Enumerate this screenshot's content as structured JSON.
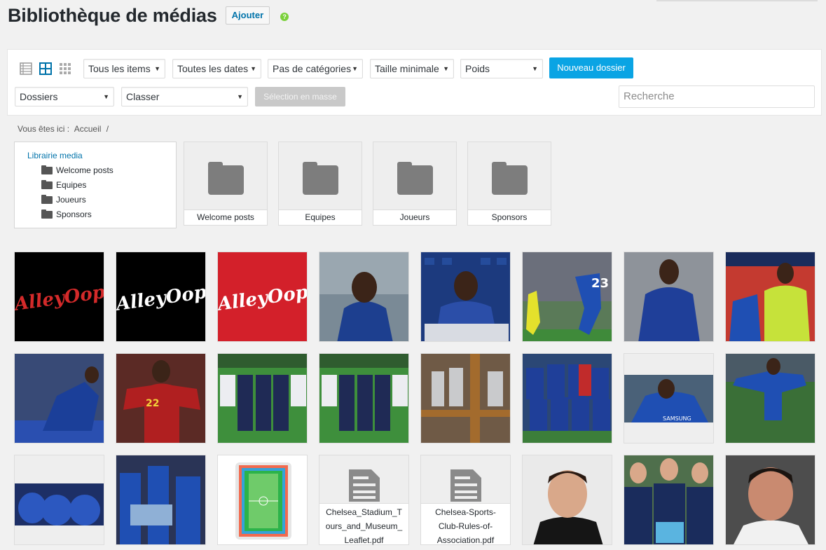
{
  "header": {
    "title": "Bibliothèque de médias",
    "add_label": "Ajouter",
    "help": "?"
  },
  "toolbar": {
    "filters": [
      {
        "label": "Tous les items"
      },
      {
        "label": "Toutes les dates"
      },
      {
        "label": "Pas de catégories"
      },
      {
        "label": "Taille minimale"
      },
      {
        "label": "Poids"
      }
    ],
    "new_folder_label": "Nouveau dossier",
    "folders_select": "Dossiers",
    "sort_select": "Classer",
    "bulk_select_label": "Sélection en masse",
    "search_placeholder": "Recherche",
    "accent_color": "#0aa4e4"
  },
  "breadcrumb": {
    "prefix": "Vous êtes ici :",
    "home": "Accueil",
    "separator": "/"
  },
  "tree": {
    "root": "Librairie media",
    "items": [
      "Welcome posts",
      "Equipes",
      "Joueurs",
      "Sponsors"
    ]
  },
  "folders": [
    "Welcome posts",
    "Equipes",
    "Joueurs",
    "Sponsors"
  ],
  "documents": [
    {
      "name": "Chelsea_Stadium_Tours_and_Museum_Leaflet.pdf",
      "lines": [
        "Chelsea_Stadium_T",
        "ours_and_Museum_",
        "Leaflet.pdf"
      ]
    },
    {
      "name": "Chelsea-Sports-Club-Rules-of-Association.pdf",
      "lines": [
        "Chelsea-Sports-",
        "Club-Rules-of-",
        "Association.pdf"
      ]
    }
  ],
  "logo_text": "AlleyOop",
  "thumbnails": [
    "alleyoop-logo-red-on-black",
    "alleyoop-logo-white-on-black",
    "alleyoop-logo-white-on-red",
    "player-photo",
    "player-signing-photo",
    "player-match-photo",
    "player-blue-kit-photo",
    "player-presentation-photo",
    "celebration-photo",
    "belgium-player-photo",
    "staff-group-photo",
    "staff-group-photo-2",
    "trophy-cabinet-photo",
    "team-lineup-photo",
    "player-wide-photo",
    "player-running-photo",
    "team-celebration-photo",
    "fans-banner-photo",
    "stadium-seating-map",
    "document-1",
    "document-2",
    "portrait-young-man",
    "coaches-trophy-photo",
    "coach-portrait"
  ]
}
